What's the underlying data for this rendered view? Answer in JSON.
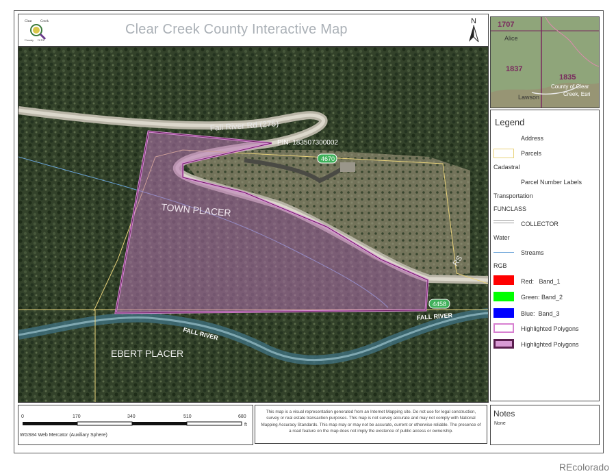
{
  "header": {
    "title": "Clear Creek County Interactive Map",
    "logo_text_top": "Clear",
    "logo_text_top2": "Creek",
    "logo_text_bottom": "County",
    "logo_text_bottom2": "G.I.S.",
    "north_label": "N"
  },
  "map": {
    "road_label": "Fall River Rd (275)",
    "pin_label": "PIN: 183507300002",
    "address_1": "4670",
    "address_2": "4458",
    "place_town": "TOWN PLACER",
    "place_ebert": "EBERT PLACER",
    "river_1": "FALL RIVER",
    "river_2": "FALL RIVER",
    "partial_road_label": "RS"
  },
  "inset": {
    "num_1": "1707",
    "num_2": "1837",
    "num_3": "1835",
    "town_1": "Alice",
    "town_2": "Lawson",
    "credit_1": "County of Clear",
    "credit_2": "Creek, Esri"
  },
  "legend": {
    "title": "Legend",
    "items": [
      {
        "label": "Address"
      },
      {
        "label": "Parcels"
      },
      {
        "label": "Cadastral"
      },
      {
        "label": "Parcel Number Labels"
      },
      {
        "label": "Transportation"
      },
      {
        "label": "FUNCLASS"
      },
      {
        "label": "COLLECTOR"
      },
      {
        "label": "Water"
      },
      {
        "label": "Streams"
      },
      {
        "label": "RGB"
      },
      {
        "label": "Red:   Band_1"
      },
      {
        "label": "Green: Band_2"
      },
      {
        "label": "Blue:  Band_3"
      },
      {
        "label": "Highlighted Polygons"
      },
      {
        "label": "Highlighted Polygons"
      }
    ],
    "colors": {
      "parcels": "#e8d27a",
      "collector": "#9a9a9a",
      "streams": "#6aa3d8",
      "red": "#ff0000",
      "green": "#00ff00",
      "blue": "#0000ff",
      "highlight_outline": "#d77fd0",
      "highlight_fill": "#5a1e4e"
    }
  },
  "scale": {
    "ticks": [
      "0",
      "170",
      "340",
      "510",
      "680"
    ],
    "unit": "ft",
    "projection": "WGS84 Web Mercator (Auxiliary Sphere)"
  },
  "disclaimer": "This map is a visual representation generated from an Internet Mapping site. Do not use for legal construction, survey or real estate transaction purposes. This map is not survey accurate and may not comply with National Mapping Accuracy Standards. This map may or may not be accurate, current or otherwise reliable. The presence of a road feature on the map does not imply the existence of public access or ownership.",
  "notes": {
    "title": "Notes",
    "body": "None"
  },
  "watermark": "REcolorado"
}
